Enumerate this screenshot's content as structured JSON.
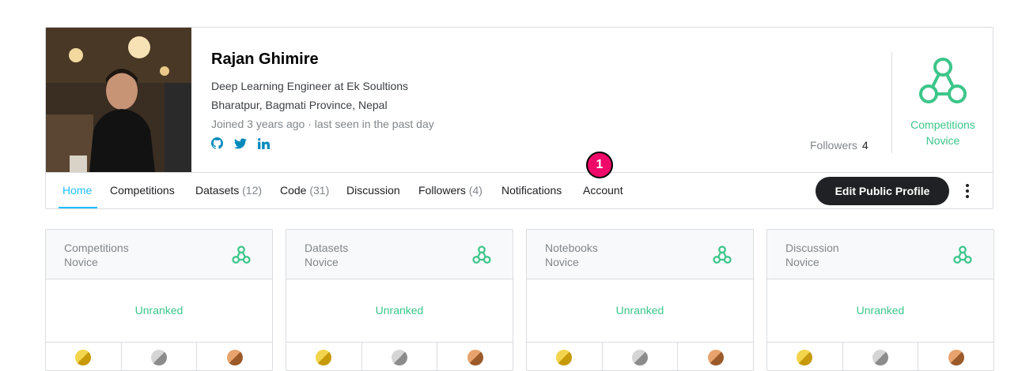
{
  "profile": {
    "name": "Rajan Ghimire",
    "occupation": "Deep Learning Engineer at Ek Soultions",
    "location": "Bharatpur, Bagmati Province, Nepal",
    "joined": "Joined 3 years ago · last seen in the past day",
    "social_icons": [
      "github-icon",
      "twitter-icon",
      "linkedin-icon"
    ],
    "followers_label": "Followers",
    "followers_count": "4",
    "tier_line1": "Competitions",
    "tier_line2": "Novice"
  },
  "tabs": [
    {
      "label": "Home",
      "count": ""
    },
    {
      "label": "Competitions",
      "count": ""
    },
    {
      "label": "Datasets",
      "count": "(12)"
    },
    {
      "label": "Code",
      "count": "(31)"
    },
    {
      "label": "Discussion",
      "count": ""
    },
    {
      "label": "Followers",
      "count": "(4)"
    },
    {
      "label": "Notifications",
      "count": ""
    },
    {
      "label": "Account",
      "count": ""
    }
  ],
  "notification_badge": "1",
  "edit_button": "Edit Public Profile",
  "stat_cards": [
    {
      "title1": "Competitions",
      "title2": "Novice",
      "rank": "Unranked"
    },
    {
      "title1": "Datasets",
      "title2": "Novice",
      "rank": "Unranked"
    },
    {
      "title1": "Notebooks",
      "title2": "Novice",
      "rank": "Unranked"
    },
    {
      "title1": "Discussion",
      "title2": "Novice",
      "rank": "Unranked"
    }
  ],
  "colors": {
    "accent": "#20beff",
    "tier": "#3cc68a",
    "badge": "#ef0a6a",
    "button": "#202124"
  }
}
